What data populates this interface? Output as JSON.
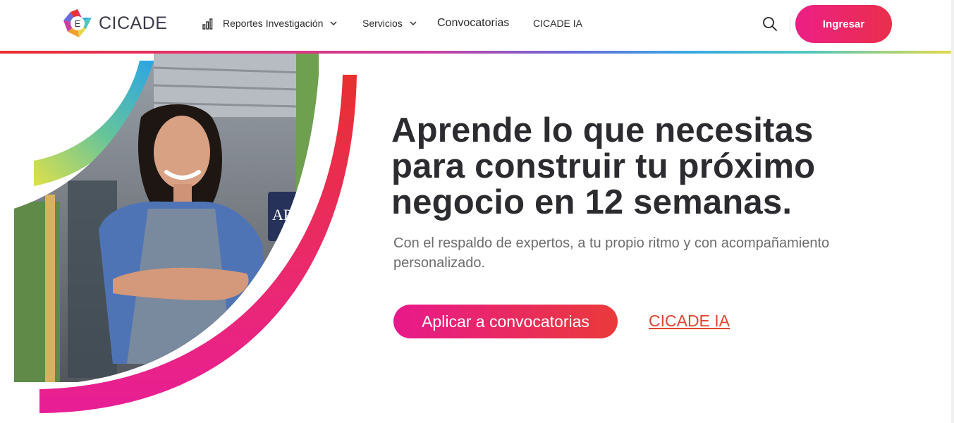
{
  "header": {
    "logo_text": "CICADE",
    "nav": [
      {
        "label": "Reportes Investigación",
        "icon": "bar-chart-icon",
        "has_dropdown": true
      },
      {
        "label": "Servicios",
        "has_dropdown": true
      },
      {
        "label": "Convocatorias",
        "has_dropdown": false
      },
      {
        "label": "CICADE IA",
        "has_dropdown": false
      }
    ],
    "search_icon": "search-icon",
    "login_label": "Ingresar"
  },
  "hero": {
    "title": "Aprende lo que necesitas para construir tu próximo negocio en 12 semanas.",
    "subtitle": "Con el respaldo de expertos, a tu propio ritmo y con acompañamiento personalizado.",
    "primary_cta": "Aplicar a convocatorias",
    "secondary_link": "CICADE IA",
    "sign_text": "AP"
  },
  "colors": {
    "brand_pink": "#ec1f86",
    "brand_red": "#ea2f4a",
    "link_red": "#e0452f",
    "title_text": "#2c2c30"
  }
}
